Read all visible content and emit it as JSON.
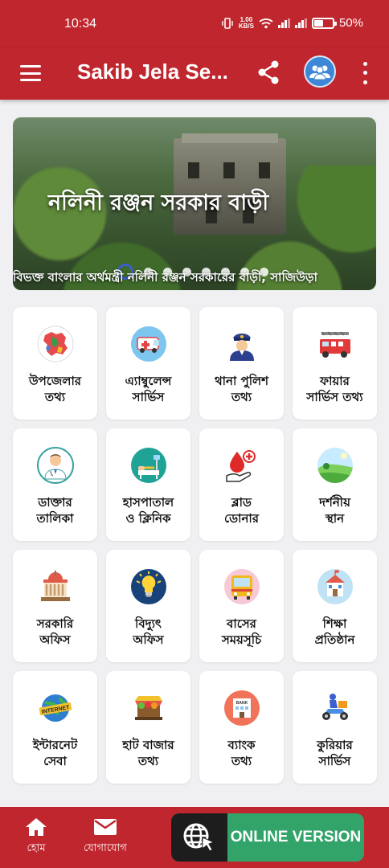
{
  "status_bar": {
    "time": "10:34",
    "net_speed_value": "1.00",
    "net_speed_unit": "KB/S",
    "battery_percent": "50%",
    "battery_level": 0.5
  },
  "app_bar": {
    "title": "Sakib Jela Se..."
  },
  "banner": {
    "title": "নলিনী রঞ্জন সরকার বাড়ী",
    "caption": "বিভক্ত বাংলার অর্থমন্ত্রী নলিনী রঞ্জন সরকারের বাড়ী, সাজিউড়া",
    "slide_count": 8,
    "active_slide": 1
  },
  "services": [
    {
      "label": "উপজেলার\nতথ্য",
      "icon": "map-icon"
    },
    {
      "label": "এ্যাম্বুলেন্স\nসার্ভিস",
      "icon": "ambulance-icon"
    },
    {
      "label": "থানা পুলিশ\nতথ্য",
      "icon": "police-icon"
    },
    {
      "label": "ফায়ার\nসার্ভিস তথ্য",
      "icon": "fire-truck-icon"
    },
    {
      "label": "ডাক্তার\nতালিকা",
      "icon": "doctor-icon"
    },
    {
      "label": "হাসপাতাল\nও ক্লিনিক",
      "icon": "hospital-icon"
    },
    {
      "label": "ব্লাড\nডোনার",
      "icon": "blood-donation-icon"
    },
    {
      "label": "দর্শনীয়\nস্থান",
      "icon": "landscape-icon"
    },
    {
      "label": "সরকারি\nঅফিস",
      "icon": "government-building-icon"
    },
    {
      "label": "বিদ্যুৎ\nঅফিস",
      "icon": "light-bulb-icon"
    },
    {
      "label": "বাসের\nসময়সূচি",
      "icon": "bus-icon"
    },
    {
      "label": "শিক্ষা\nপ্রতিষ্ঠান",
      "icon": "school-icon"
    },
    {
      "label": "ইন্টারনেট\nসেবা",
      "icon": "internet-globe-icon"
    },
    {
      "label": "হাট বাজার\nতথ্য",
      "icon": "market-icon"
    },
    {
      "label": "ব্যাংক\nতথ্য",
      "icon": "bank-icon"
    },
    {
      "label": "কুরিয়ার\nসার্ভিস",
      "icon": "courier-scooter-icon"
    }
  ],
  "bottom_nav": {
    "home_label": "হোম",
    "contact_label": "যোগাযোগ",
    "online_label": "ONLINE VERSION"
  },
  "colors": {
    "primary": "#c0262d",
    "online_green": "#32a46a",
    "group_blue": "#3e86d6"
  }
}
